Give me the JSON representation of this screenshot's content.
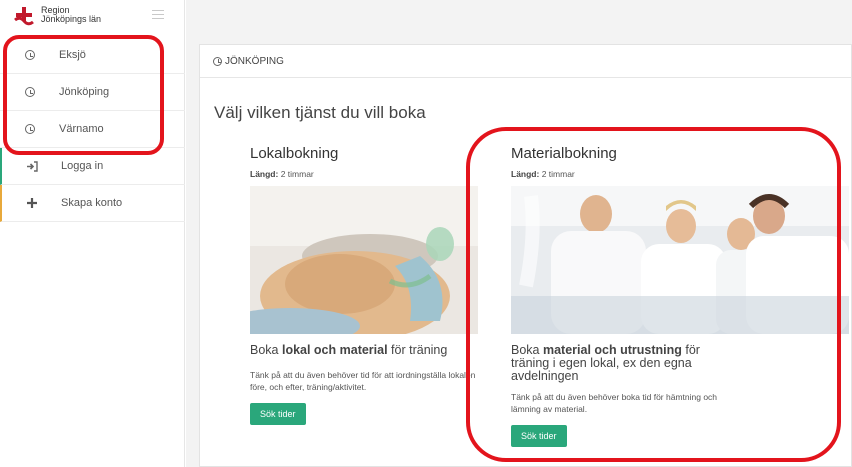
{
  "brand": {
    "name_line1": "Region",
    "name_line2": "Jönköpings län"
  },
  "sidebar": {
    "items": [
      {
        "label": "Eksjö",
        "icon": "clock-icon"
      },
      {
        "label": "Jönköping",
        "icon": "clock-icon"
      },
      {
        "label": "Värnamo",
        "icon": "clock-icon"
      },
      {
        "label": "Logga in",
        "icon": "sign-in-icon"
      },
      {
        "label": "Skapa konto",
        "icon": "plus-icon"
      }
    ]
  },
  "main": {
    "panel_header": "JÖNKÖPING",
    "heading": "Välj vilken tjänst du vill boka",
    "cards": [
      {
        "title": "Lokalbokning",
        "length_label": "Längd:",
        "length_value": "2 timmar",
        "head_pre": "Boka ",
        "head_bold": "lokal och material",
        "head_post": " för träning",
        "desc": "Tänk på att du även behöver tid för att iordningställa lokalen före, och efter, träning/aktivitet.",
        "button": "Sök tider"
      },
      {
        "title": "Materialbokning",
        "length_label": "Längd:",
        "length_value": "2 timmar",
        "head_pre": "Boka ",
        "head_bold": "material och utrustning",
        "head_post": " för träning i egen lokal, ex den egna avdelningen",
        "desc": "Tänk på att du även behöver boka tid för hämtning och lämning av material.",
        "button": "Sök tider"
      }
    ]
  },
  "colors": {
    "accent_green": "#2aa77b",
    "highlight_red": "#e3141c",
    "warning_orange": "#e8a93b"
  }
}
